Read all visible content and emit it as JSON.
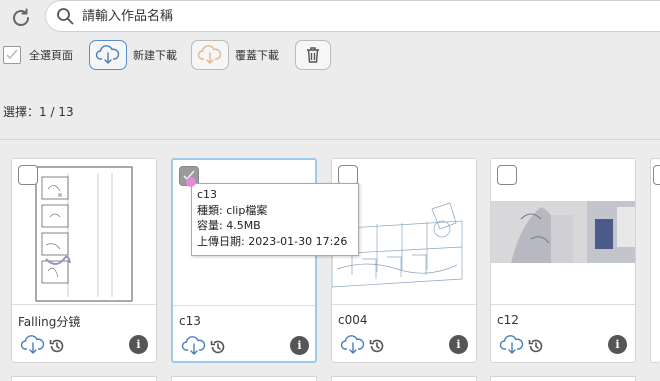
{
  "search": {
    "placeholder": "請輸入作品名稱"
  },
  "toolbar": {
    "select_all_label": "全選頁面",
    "download_label": "新建下載",
    "overwrite_label": "覆蓋下載"
  },
  "selection": {
    "text": "選擇：1 / 13"
  },
  "cards": [
    {
      "name": "Falling分镜",
      "checked": false
    },
    {
      "name": "c13",
      "checked": true
    },
    {
      "name": "c004",
      "checked": false
    },
    {
      "name": "c12",
      "checked": false
    }
  ],
  "tooltip": {
    "name": "c13",
    "type": "種類: clip檔案",
    "size": "容量: 4.5MB",
    "date": "上傳日期: 2023-01-30 17:26"
  },
  "colors": {
    "accent": "#5a8ec9",
    "selected_border": "#9ccbea",
    "cursor": "#e58ad8"
  }
}
